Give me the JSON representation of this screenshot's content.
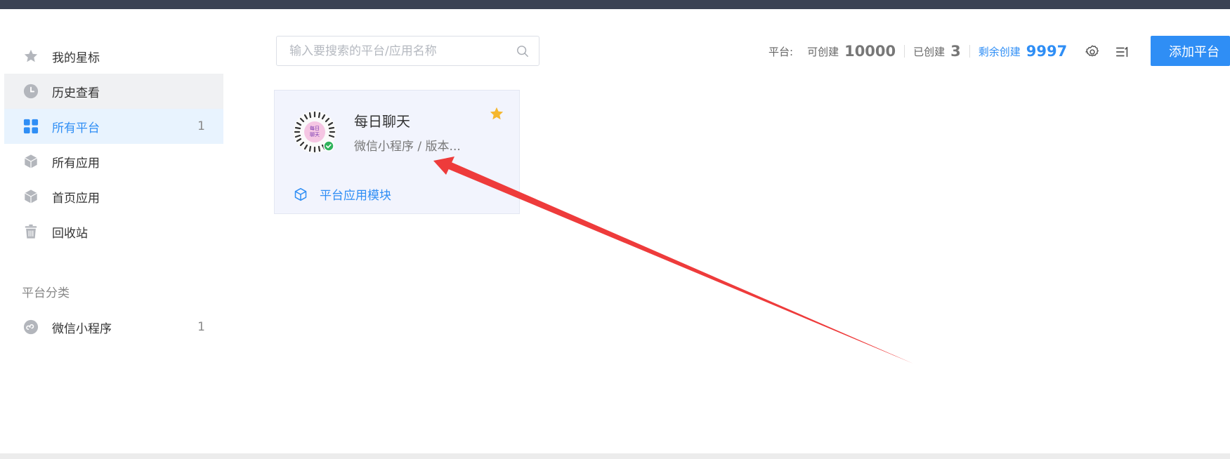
{
  "sidebar": {
    "items": [
      {
        "label": "我的星标",
        "icon": "star-icon"
      },
      {
        "label": "历史查看",
        "icon": "clock-icon"
      },
      {
        "label": "所有平台",
        "icon": "grid-icon",
        "count": "1",
        "active": true
      },
      {
        "label": "所有应用",
        "icon": "cube-icon"
      },
      {
        "label": "首页应用",
        "icon": "cube-icon"
      },
      {
        "label": "回收站",
        "icon": "trash-icon"
      }
    ],
    "category_title": "平台分类",
    "categories": [
      {
        "label": "微信小程序",
        "icon": "miniprogram-icon",
        "count": "1"
      }
    ]
  },
  "search": {
    "placeholder": "输入要搜索的平台/应用名称"
  },
  "stats": {
    "platform_label": "平台:",
    "creatable_label": "可创建",
    "creatable_value": "10000",
    "created_label": "已创建",
    "created_value": "3",
    "remaining_label": "剩余创建",
    "remaining_value": "9997"
  },
  "toolbar": {
    "add_label": "添加平台"
  },
  "card": {
    "title": "每日聊天",
    "subtitle": "微信小程序 / 版本...",
    "qr_text": "每日聊天",
    "module_label": "平台应用模块",
    "starred": true
  },
  "colors": {
    "accent": "#2f8ef5",
    "star": "#f5b72e",
    "arrow": "#ee3b3b",
    "topbar": "#3b4253"
  }
}
